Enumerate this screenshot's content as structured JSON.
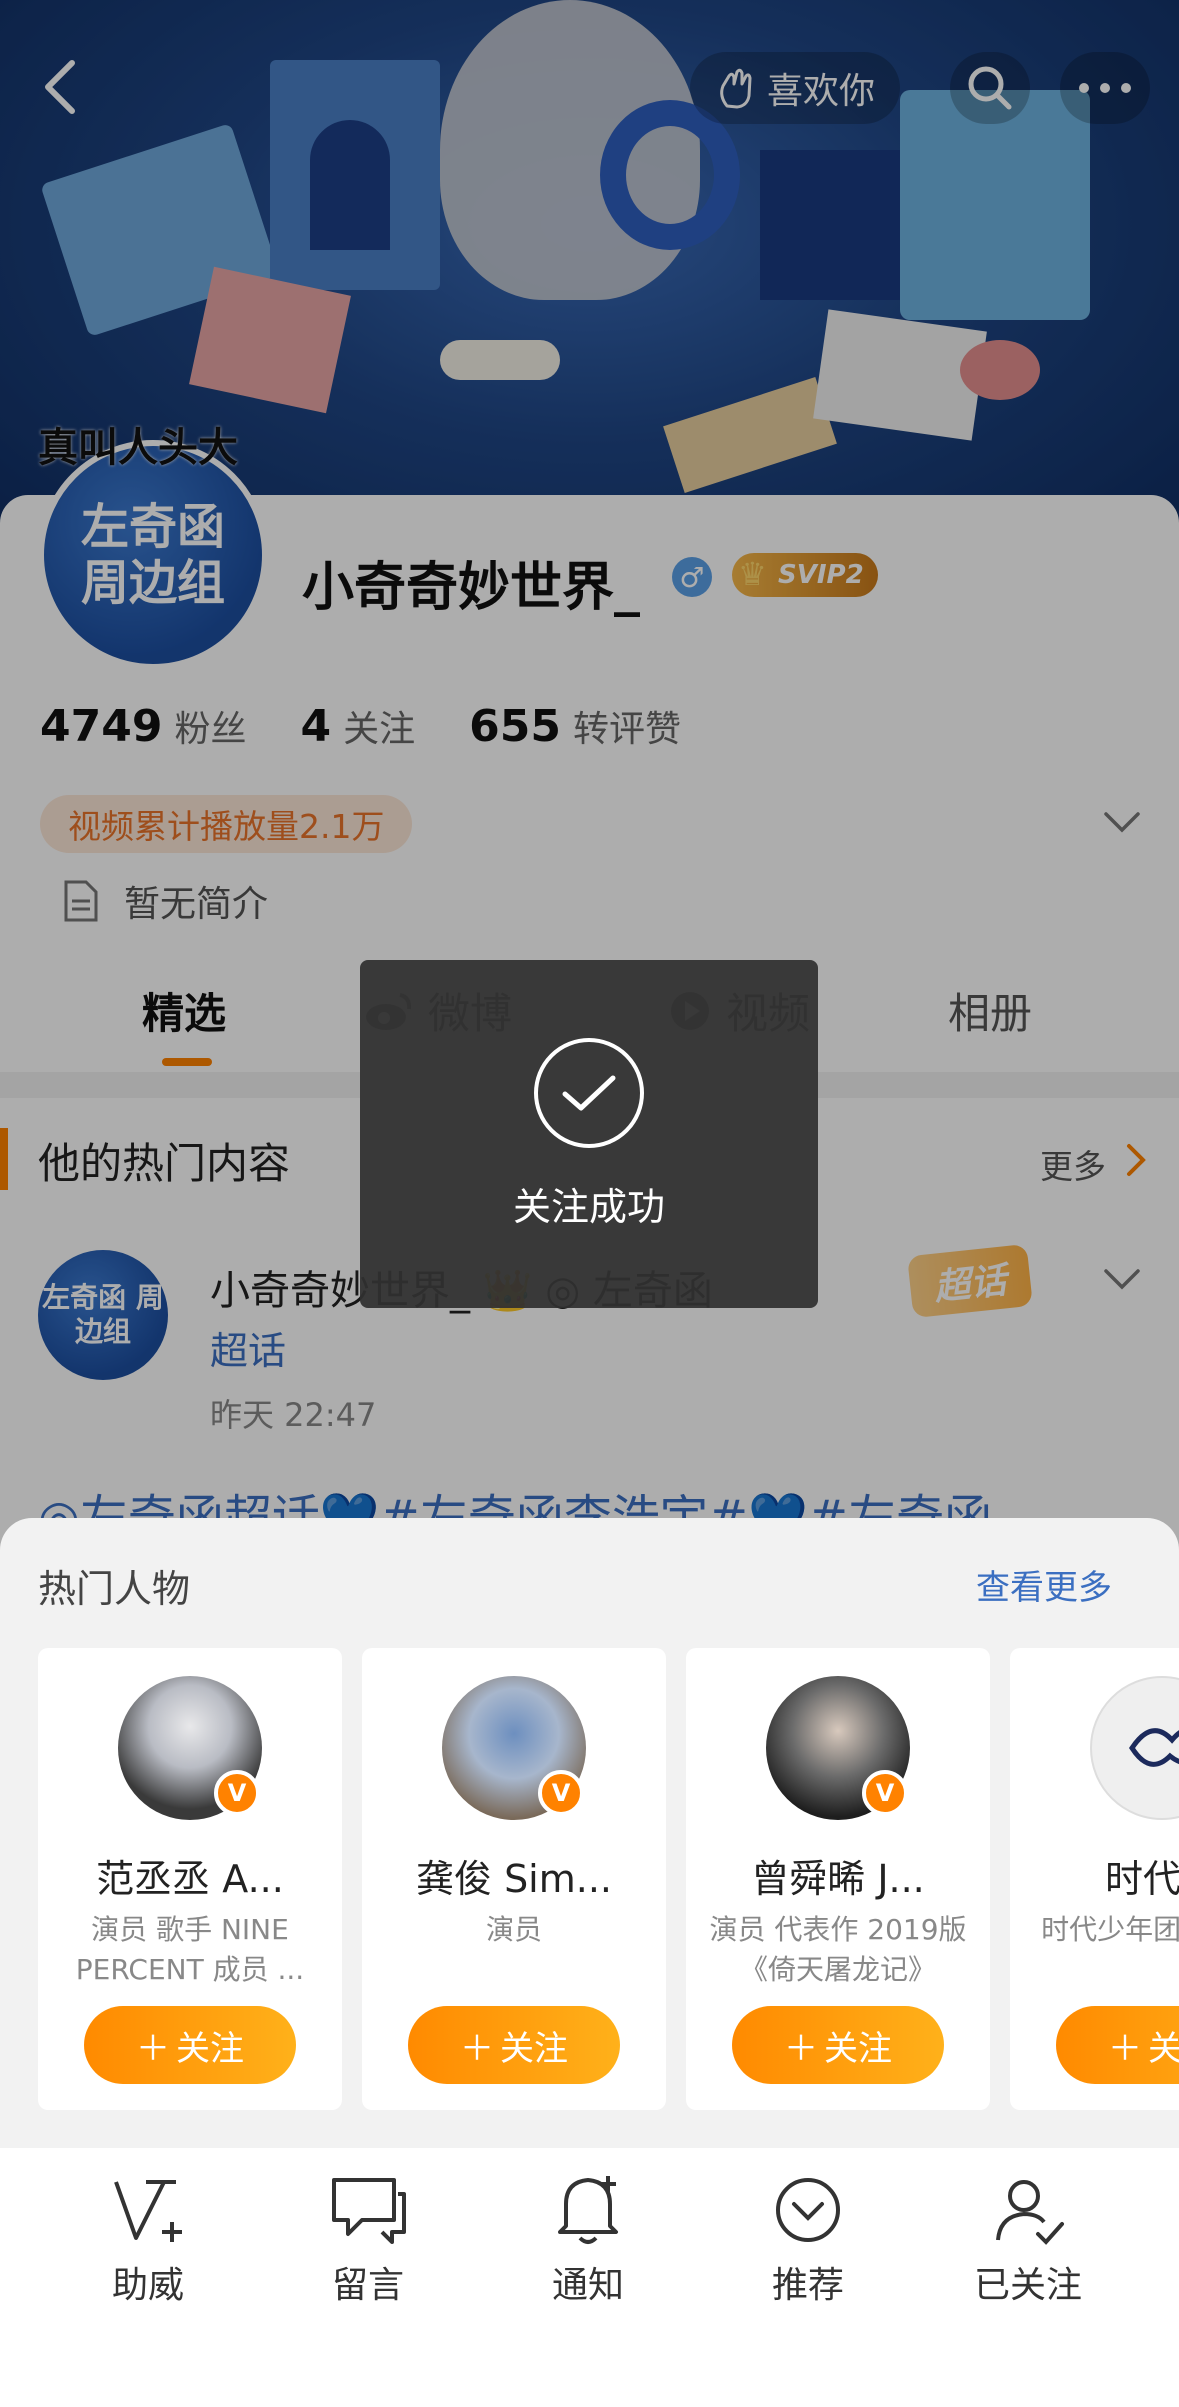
{
  "header": {
    "like_label": "喜欢你"
  },
  "profile": {
    "avatar_text_top": "左奇函",
    "avatar_text_bottom": "周边组",
    "avatar_caption": "真叫人头大",
    "nickname": "小奇奇妙世界_",
    "gender_symbol": "♂",
    "vip_label": "SVIP2",
    "stats": [
      {
        "value": "4749",
        "label": "粉丝"
      },
      {
        "value": "4",
        "label": "关注"
      },
      {
        "value": "655",
        "label": "转评赞"
      }
    ],
    "play_count": "视频累计播放量2.1万",
    "bio": "暂无简介"
  },
  "tabs": [
    {
      "label": "精选"
    },
    {
      "label": "微博"
    },
    {
      "label": "视频"
    },
    {
      "label": "相册"
    }
  ],
  "hot": {
    "title": "他的热门内容",
    "more": "更多"
  },
  "post": {
    "avatar_text": "左奇函 周边组",
    "name": "小奇奇妙世界_ 👑 ◎ 左奇函",
    "sub": "超话",
    "time": "昨天 22:47",
    "badge": "超话",
    "text": "◎左奇函超话💙#左奇函李浩宇#💙#左奇函"
  },
  "toast": {
    "text": "关注成功"
  },
  "recommend": {
    "title": "热门人物",
    "more": "查看更多",
    "cards": [
      {
        "name": "范丞丞 A...",
        "desc": "演员 歌手 NINE PERCENT 成员 ...",
        "follow": "关注",
        "avatar_color": "#3a3a3a"
      },
      {
        "name": "龚俊 Sim...",
        "desc": "演员",
        "follow": "关注",
        "avatar_color": "#7a8ea8"
      },
      {
        "name": "曾舜晞 J...",
        "desc": "演员 代表作 2019版《倚天屠龙记》",
        "follow": "关注",
        "avatar_color": "#2a2a2a"
      },
      {
        "name": "时代少",
        "desc": "时代少年团 员 张真",
        "follow": "关注",
        "avatar_color": "#eeeeee"
      }
    ]
  },
  "bottom_bar": [
    {
      "label": "助威",
      "icon": "cheer-icon"
    },
    {
      "label": "留言",
      "icon": "message-icon"
    },
    {
      "label": "通知",
      "icon": "bell-icon"
    },
    {
      "label": "推荐",
      "icon": "recommend-icon"
    },
    {
      "label": "已关注",
      "icon": "followed-icon"
    }
  ],
  "colors": {
    "accent": "#ff8200",
    "link": "#3b6fc1",
    "banner": "#1f4685"
  }
}
